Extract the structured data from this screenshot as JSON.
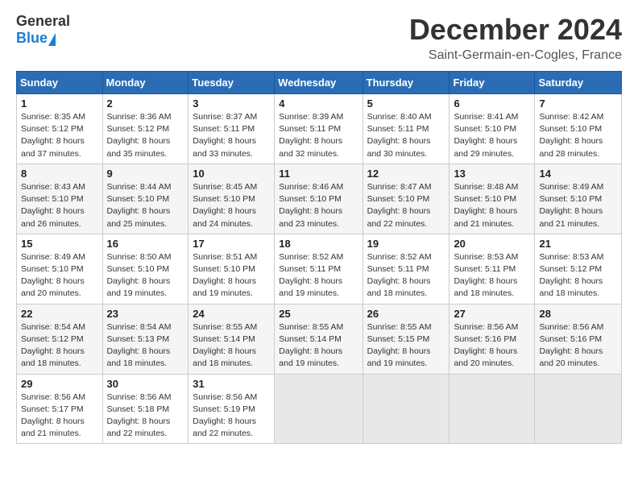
{
  "logo": {
    "general": "General",
    "blue": "Blue"
  },
  "header": {
    "month": "December 2024",
    "location": "Saint-Germain-en-Cogles, France"
  },
  "weekdays": [
    "Sunday",
    "Monday",
    "Tuesday",
    "Wednesday",
    "Thursday",
    "Friday",
    "Saturday"
  ],
  "weeks": [
    [
      {
        "day": "1",
        "sunrise": "Sunrise: 8:35 AM",
        "sunset": "Sunset: 5:12 PM",
        "daylight": "Daylight: 8 hours and 37 minutes."
      },
      {
        "day": "2",
        "sunrise": "Sunrise: 8:36 AM",
        "sunset": "Sunset: 5:12 PM",
        "daylight": "Daylight: 8 hours and 35 minutes."
      },
      {
        "day": "3",
        "sunrise": "Sunrise: 8:37 AM",
        "sunset": "Sunset: 5:11 PM",
        "daylight": "Daylight: 8 hours and 33 minutes."
      },
      {
        "day": "4",
        "sunrise": "Sunrise: 8:39 AM",
        "sunset": "Sunset: 5:11 PM",
        "daylight": "Daylight: 8 hours and 32 minutes."
      },
      {
        "day": "5",
        "sunrise": "Sunrise: 8:40 AM",
        "sunset": "Sunset: 5:11 PM",
        "daylight": "Daylight: 8 hours and 30 minutes."
      },
      {
        "day": "6",
        "sunrise": "Sunrise: 8:41 AM",
        "sunset": "Sunset: 5:10 PM",
        "daylight": "Daylight: 8 hours and 29 minutes."
      },
      {
        "day": "7",
        "sunrise": "Sunrise: 8:42 AM",
        "sunset": "Sunset: 5:10 PM",
        "daylight": "Daylight: 8 hours and 28 minutes."
      }
    ],
    [
      {
        "day": "8",
        "sunrise": "Sunrise: 8:43 AM",
        "sunset": "Sunset: 5:10 PM",
        "daylight": "Daylight: 8 hours and 26 minutes."
      },
      {
        "day": "9",
        "sunrise": "Sunrise: 8:44 AM",
        "sunset": "Sunset: 5:10 PM",
        "daylight": "Daylight: 8 hours and 25 minutes."
      },
      {
        "day": "10",
        "sunrise": "Sunrise: 8:45 AM",
        "sunset": "Sunset: 5:10 PM",
        "daylight": "Daylight: 8 hours and 24 minutes."
      },
      {
        "day": "11",
        "sunrise": "Sunrise: 8:46 AM",
        "sunset": "Sunset: 5:10 PM",
        "daylight": "Daylight: 8 hours and 23 minutes."
      },
      {
        "day": "12",
        "sunrise": "Sunrise: 8:47 AM",
        "sunset": "Sunset: 5:10 PM",
        "daylight": "Daylight: 8 hours and 22 minutes."
      },
      {
        "day": "13",
        "sunrise": "Sunrise: 8:48 AM",
        "sunset": "Sunset: 5:10 PM",
        "daylight": "Daylight: 8 hours and 21 minutes."
      },
      {
        "day": "14",
        "sunrise": "Sunrise: 8:49 AM",
        "sunset": "Sunset: 5:10 PM",
        "daylight": "Daylight: 8 hours and 21 minutes."
      }
    ],
    [
      {
        "day": "15",
        "sunrise": "Sunrise: 8:49 AM",
        "sunset": "Sunset: 5:10 PM",
        "daylight": "Daylight: 8 hours and 20 minutes."
      },
      {
        "day": "16",
        "sunrise": "Sunrise: 8:50 AM",
        "sunset": "Sunset: 5:10 PM",
        "daylight": "Daylight: 8 hours and 19 minutes."
      },
      {
        "day": "17",
        "sunrise": "Sunrise: 8:51 AM",
        "sunset": "Sunset: 5:10 PM",
        "daylight": "Daylight: 8 hours and 19 minutes."
      },
      {
        "day": "18",
        "sunrise": "Sunrise: 8:52 AM",
        "sunset": "Sunset: 5:11 PM",
        "daylight": "Daylight: 8 hours and 19 minutes."
      },
      {
        "day": "19",
        "sunrise": "Sunrise: 8:52 AM",
        "sunset": "Sunset: 5:11 PM",
        "daylight": "Daylight: 8 hours and 18 minutes."
      },
      {
        "day": "20",
        "sunrise": "Sunrise: 8:53 AM",
        "sunset": "Sunset: 5:11 PM",
        "daylight": "Daylight: 8 hours and 18 minutes."
      },
      {
        "day": "21",
        "sunrise": "Sunrise: 8:53 AM",
        "sunset": "Sunset: 5:12 PM",
        "daylight": "Daylight: 8 hours and 18 minutes."
      }
    ],
    [
      {
        "day": "22",
        "sunrise": "Sunrise: 8:54 AM",
        "sunset": "Sunset: 5:12 PM",
        "daylight": "Daylight: 8 hours and 18 minutes."
      },
      {
        "day": "23",
        "sunrise": "Sunrise: 8:54 AM",
        "sunset": "Sunset: 5:13 PM",
        "daylight": "Daylight: 8 hours and 18 minutes."
      },
      {
        "day": "24",
        "sunrise": "Sunrise: 8:55 AM",
        "sunset": "Sunset: 5:14 PM",
        "daylight": "Daylight: 8 hours and 18 minutes."
      },
      {
        "day": "25",
        "sunrise": "Sunrise: 8:55 AM",
        "sunset": "Sunset: 5:14 PM",
        "daylight": "Daylight: 8 hours and 19 minutes."
      },
      {
        "day": "26",
        "sunrise": "Sunrise: 8:55 AM",
        "sunset": "Sunset: 5:15 PM",
        "daylight": "Daylight: 8 hours and 19 minutes."
      },
      {
        "day": "27",
        "sunrise": "Sunrise: 8:56 AM",
        "sunset": "Sunset: 5:16 PM",
        "daylight": "Daylight: 8 hours and 20 minutes."
      },
      {
        "day": "28",
        "sunrise": "Sunrise: 8:56 AM",
        "sunset": "Sunset: 5:16 PM",
        "daylight": "Daylight: 8 hours and 20 minutes."
      }
    ],
    [
      {
        "day": "29",
        "sunrise": "Sunrise: 8:56 AM",
        "sunset": "Sunset: 5:17 PM",
        "daylight": "Daylight: 8 hours and 21 minutes."
      },
      {
        "day": "30",
        "sunrise": "Sunrise: 8:56 AM",
        "sunset": "Sunset: 5:18 PM",
        "daylight": "Daylight: 8 hours and 22 minutes."
      },
      {
        "day": "31",
        "sunrise": "Sunrise: 8:56 AM",
        "sunset": "Sunset: 5:19 PM",
        "daylight": "Daylight: 8 hours and 22 minutes."
      },
      null,
      null,
      null,
      null
    ]
  ]
}
